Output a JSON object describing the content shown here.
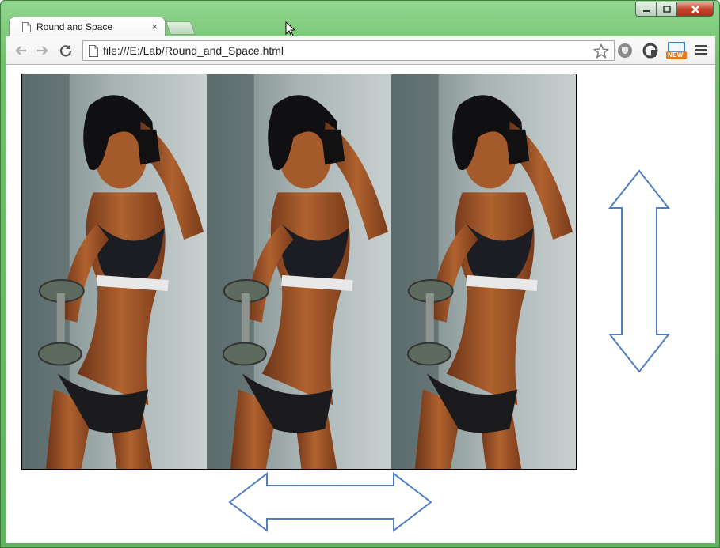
{
  "window": {
    "tab_title": "Round and Space",
    "tab_close": "×",
    "url": "file:///E:/Lab/Round_and_Space.html"
  },
  "colors": {
    "frame_green": "#7fcb7c",
    "arrow_stroke": "#4f7fc2",
    "close_red": "#c7452c"
  },
  "icons": {
    "back": "back-arrow-icon",
    "forward": "forward-arrow-icon",
    "reload": "reload-icon",
    "page": "page-icon",
    "star": "star-icon",
    "menu": "hamburger-menu-icon"
  },
  "extensions": {
    "badge_new": "NEW"
  },
  "content": {
    "photo_count": 3,
    "photo_alt": "Woman with dumbbell"
  }
}
